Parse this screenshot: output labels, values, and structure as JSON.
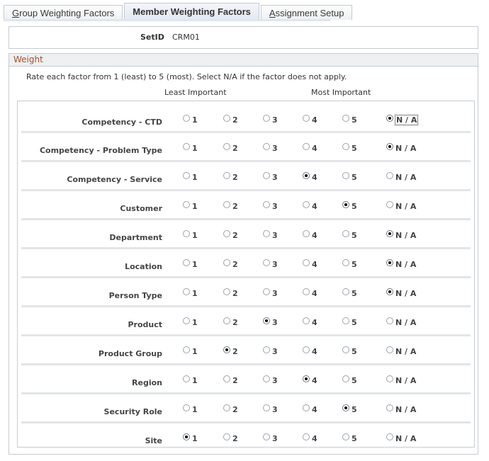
{
  "tabs": [
    {
      "label_first": "G",
      "label_rest": "roup Weighting Factors",
      "active": false
    },
    {
      "label_first": "",
      "label_rest": "Member Weighting Factors",
      "active": true
    },
    {
      "label_first": "A",
      "label_rest": "ssignment Setup",
      "active": false
    }
  ],
  "setid": {
    "label": "SetID",
    "value": "CRM01"
  },
  "weight": {
    "title": "Weight",
    "instructions": "Rate each factor from 1 (least) to 5 (most). Select N/A if the factor does not apply.",
    "least_label": "Least Important",
    "most_label": "Most Important",
    "option_labels": [
      "1",
      "2",
      "3",
      "4",
      "5",
      "N / A"
    ],
    "factors": [
      {
        "name": "Competency - CTD",
        "selected": "N / A",
        "focused": true
      },
      {
        "name": "Competency - Problem Type",
        "selected": "N / A"
      },
      {
        "name": "Competency - Service",
        "selected": "4"
      },
      {
        "name": "Customer",
        "selected": "5"
      },
      {
        "name": "Department",
        "selected": "N / A"
      },
      {
        "name": "Location",
        "selected": "N / A"
      },
      {
        "name": "Person Type",
        "selected": "N / A"
      },
      {
        "name": "Product",
        "selected": "3"
      },
      {
        "name": "Product Group",
        "selected": "2"
      },
      {
        "name": "Region",
        "selected": "4"
      },
      {
        "name": "Security Role",
        "selected": "5"
      },
      {
        "name": "Site",
        "selected": "1"
      }
    ]
  }
}
